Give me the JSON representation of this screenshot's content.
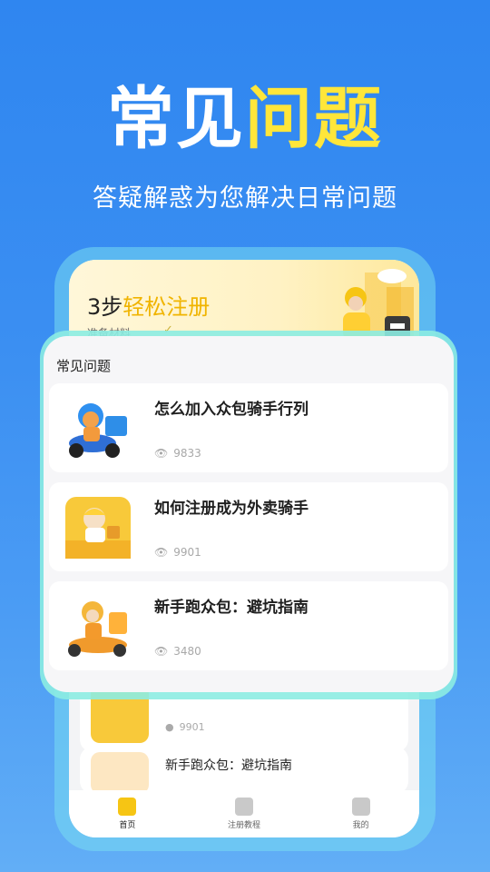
{
  "headline": {
    "part1": "常见",
    "part2": "问题"
  },
  "subheadline": "答疑解惑为您解决日常问题",
  "banner": {
    "step": "3步",
    "title": "轻松注册",
    "subtitle": "准备材料",
    "check": "✓"
  },
  "faq": {
    "heading": "常见问题",
    "items": [
      {
        "title": "怎么加入众包骑手行列",
        "views": "9833",
        "icon": "rider-scooter-icon"
      },
      {
        "title": "如何注册成为外卖骑手",
        "views": "9901",
        "icon": "courier-app-icon"
      },
      {
        "title": "新手跑众包：避坑指南",
        "views": "3480",
        "icon": "delivery-rider-icon"
      }
    ]
  },
  "background_list": {
    "items": [
      {
        "views": "9901"
      },
      {
        "title": "新手跑众包：避坑指南"
      }
    ]
  },
  "tabbar": {
    "tabs": [
      {
        "label": "首页",
        "icon": "home-icon",
        "active": true
      },
      {
        "label": "注册教程",
        "icon": "clipboard-icon",
        "active": false
      },
      {
        "label": "我的",
        "icon": "user-icon",
        "active": false
      }
    ]
  },
  "colors": {
    "accent": "#ffe63a",
    "brand_yellow": "#f6c514",
    "background": "#3b8ff2"
  }
}
